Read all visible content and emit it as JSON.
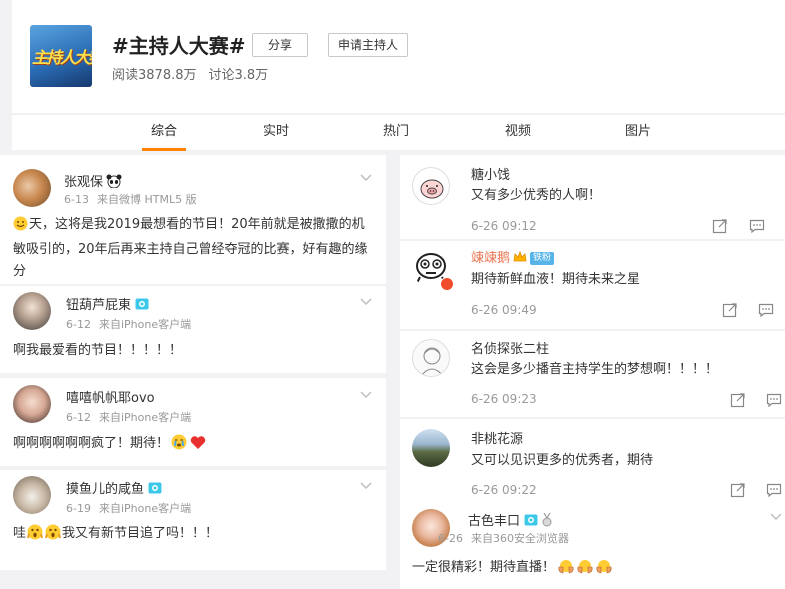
{
  "topic": {
    "title": "#主持人大赛#",
    "image_text": "主持人大赛",
    "reads": "阅读3878.8万",
    "discussions": "讨论3.8万",
    "share_label": "分享",
    "apply_label": "申请主持人"
  },
  "tabs": [
    "综合",
    "实时",
    "热门",
    "视频",
    "图片"
  ],
  "left_posts": [
    {
      "name": "张观保",
      "date": "6-13",
      "source": "来自微博 HTML5 版",
      "text": "天，这将是我2019最想看的节目！20年前就是被撒撒的机敏吸引的，20年后再来主持自己曾经夺冠的比赛，好有趣的缘分"
    },
    {
      "name": "钮葫芦屁東",
      "date": "6-12",
      "source": "来自iPhone客户端",
      "text": "啊我最爱看的节目！！！！！"
    },
    {
      "name": "嘻嘻帆帆耶ovo",
      "date": "6-12",
      "source": "来自iPhone客户端",
      "text": "啊啊啊啊啊啊疯了！期待！"
    },
    {
      "name": "摸鱼儿的咸鱼",
      "date": "6-19",
      "source": "来自iPhone客户端",
      "text_before": "哇",
      "text_after": "我又有新节目追了吗！！！"
    }
  ],
  "right_posts": [
    {
      "name": "糖小饯",
      "text": "又有多少优秀的人啊！",
      "time": "6-26 09:12"
    },
    {
      "name": "竦竦鹅",
      "text": "期待新鲜血液！期待未来之星",
      "time": "6-26 09:49",
      "badge": "铁粉"
    },
    {
      "name": "名侦探张二柱",
      "text": "这会是多少播音主持学生的梦想啊！！！！",
      "time": "6-26 09:23"
    },
    {
      "name": "非桃花源",
      "text": "又可以见识更多的优秀者，期待",
      "time": "6-26 09:22"
    },
    {
      "name": "古色丰口",
      "date": "6-26",
      "source": "来自360安全浏览器",
      "text": "一定很精彩！期待直播！"
    }
  ],
  "colors": {
    "accent": "#ff8200",
    "name_orange": "#eb7350"
  }
}
